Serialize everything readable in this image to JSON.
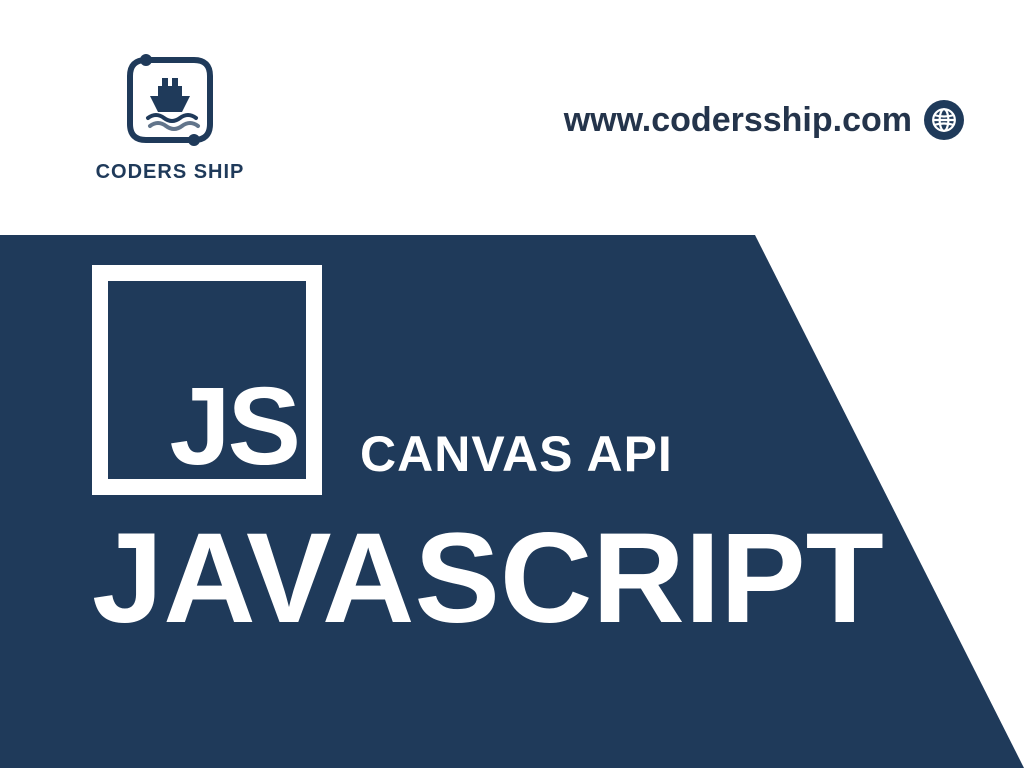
{
  "colors": {
    "navy": "#1f3a5a",
    "white": "#ffffff",
    "text_dark": "#24344b"
  },
  "header": {
    "brand": "CODERS SHIP",
    "url": "www.codersship.com"
  },
  "hero": {
    "badge_text": "JS",
    "subtitle": "CANVAS API",
    "title": "JAVASCRIPT"
  }
}
